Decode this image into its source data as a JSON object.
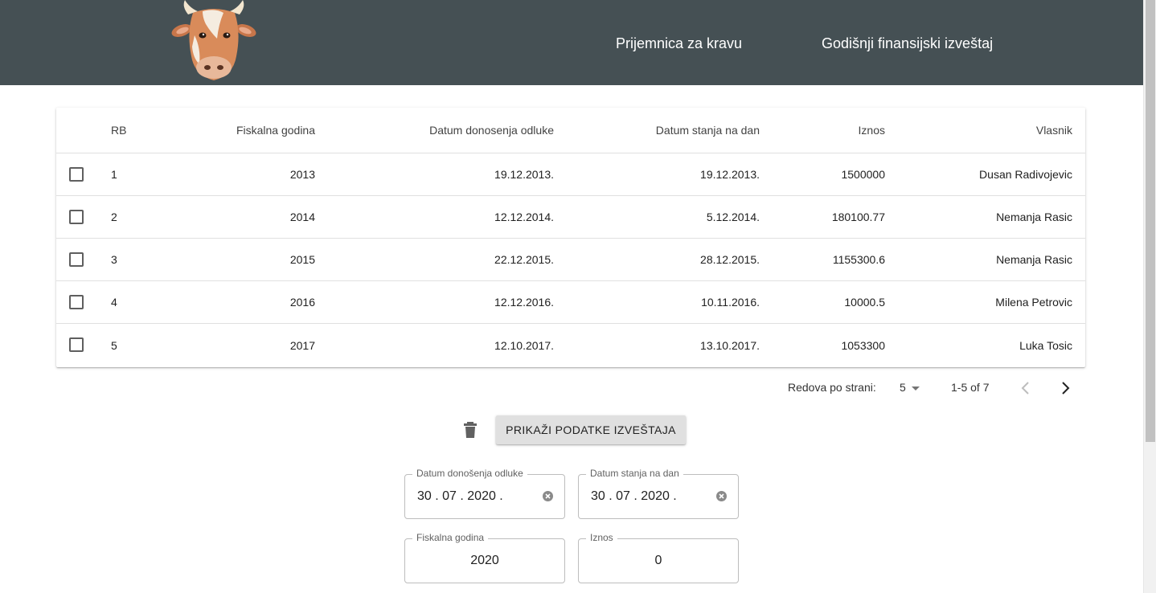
{
  "app": {
    "nav": {
      "item1": "Prijemnica za kravu",
      "item2": "Godišnji finansijski izveštaj"
    }
  },
  "table": {
    "headers": {
      "rb": "RB",
      "fiskalna": "Fiskalna godina",
      "donosenje": "Datum donosenja odluke",
      "stanje": "Datum stanja na dan",
      "iznos": "Iznos",
      "vlasnik": "Vlasnik"
    },
    "rows": [
      {
        "rb": "1",
        "fiskalna": "2013",
        "donosenje": "19.12.2013.",
        "stanje": "19.12.2013.",
        "iznos": "1500000",
        "vlasnik": "Dusan Radivojevic"
      },
      {
        "rb": "2",
        "fiskalna": "2014",
        "donosenje": "12.12.2014.",
        "stanje": "5.12.2014.",
        "iznos": "180100.77",
        "vlasnik": "Nemanja Rasic"
      },
      {
        "rb": "3",
        "fiskalna": "2015",
        "donosenje": "22.12.2015.",
        "stanje": "28.12.2015.",
        "iznos": "1155300.6",
        "vlasnik": "Nemanja Rasic"
      },
      {
        "rb": "4",
        "fiskalna": "2016",
        "donosenje": "12.12.2016.",
        "stanje": "10.11.2016.",
        "iznos": "10000.5",
        "vlasnik": "Milena Petrovic"
      },
      {
        "rb": "5",
        "fiskalna": "2017",
        "donosenje": "12.10.2017.",
        "stanje": "13.10.2017.",
        "iznos": "1053300",
        "vlasnik": "Luka Tosic"
      }
    ]
  },
  "pagination": {
    "rows_label": "Redova po strani:",
    "rows_value": "5",
    "range": "1-5 of 7"
  },
  "actions": {
    "show_button": "Prikaži podatke izveštaja"
  },
  "form": {
    "datum_donosenja": {
      "label": "Datum donošenja odluke",
      "value": "30 . 07 . 2020 ."
    },
    "datum_stanja": {
      "label": "Datum stanja na dan",
      "value": "30 . 07 . 2020 ."
    },
    "fiskalna_godina": {
      "label": "Fiskalna godina",
      "value": "2020"
    },
    "iznos": {
      "label": "Iznos",
      "value": "0"
    }
  }
}
